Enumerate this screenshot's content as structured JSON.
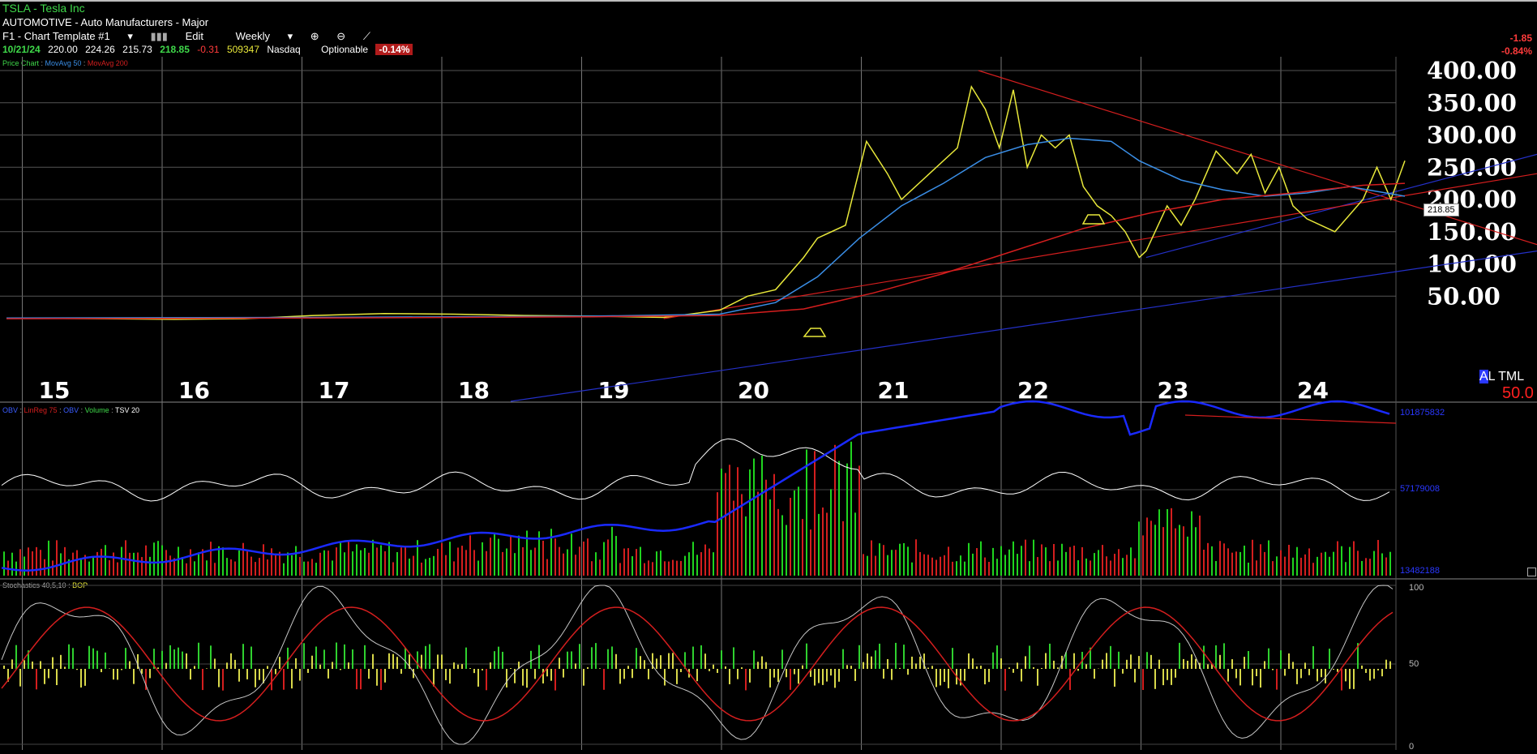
{
  "header": {
    "symbol_line": "TSLA - Tesla Inc",
    "industry": "AUTOMOTIVE - Auto Manufacturers - Major",
    "template": "F1 - Chart Template #1",
    "edit_label": "Edit",
    "period": "Weekly",
    "quote": {
      "date": "10/21/24",
      "open": "220.00",
      "high": "224.26",
      "low": "215.73",
      "close": "218.85",
      "change": "-0.31",
      "volume": "509347",
      "exchange": "Nasdaq",
      "optionable": "Optionable",
      "pct": "-0.14%"
    },
    "net_change": "-1.85",
    "net_pct": "-0.84%"
  },
  "legends": {
    "price": [
      "Price Chart",
      "MovAvg 50",
      "MovAvg 200"
    ],
    "volume": [
      "OBV",
      "LinReg 75",
      "OBV",
      "Volume",
      "TSV 20"
    ],
    "stoch": [
      "Stochastics 40,5,10",
      "BOP"
    ]
  },
  "side": {
    "altml": "AL TML",
    "fifty": "50.0",
    "last_price": "218.85"
  },
  "colors": {
    "price": "#e8e83a",
    "ma50": "#3a8ee6",
    "ma200": "#d41e1e",
    "trend_red": "#d41e1e",
    "trend_blue": "#2430c8",
    "obv": "#1a2aff",
    "tsv": "#ffffff",
    "vol_up": "#1fd41f",
    "vol_down": "#d41e1e",
    "stoch_k": "#c8c8c8",
    "stoch_d": "#d41e1e",
    "bop_up": "#2fd12f",
    "bop_mid": "#d8d84a",
    "bop_down": "#d41e1e"
  },
  "chart_data": [
    {
      "type": "line",
      "name": "price",
      "x": [
        2014.8,
        2015.5,
        2016.0,
        2016.5,
        2017.0,
        2017.5,
        2018.0,
        2018.5,
        2019.0,
        2019.5,
        2019.9,
        2020.1,
        2020.3,
        2020.5,
        2020.6,
        2020.8,
        2020.95,
        2021.1,
        2021.2,
        2021.4,
        2021.6,
        2021.7,
        2021.8,
        2021.9,
        2022.0,
        2022.1,
        2022.2,
        2022.3,
        2022.4,
        2022.5,
        2022.6,
        2022.7,
        2022.8,
        2022.9,
        2022.95,
        2023.1,
        2023.2,
        2023.3,
        2023.45,
        2023.6,
        2023.7,
        2023.8,
        2023.9,
        2024.0,
        2024.1,
        2024.3,
        2024.5,
        2024.6,
        2024.7,
        2024.8
      ],
      "y": [
        16,
        15,
        14,
        15,
        20,
        23,
        22,
        20,
        19,
        17,
        28,
        50,
        60,
        110,
        140,
        160,
        290,
        240,
        200,
        240,
        280,
        375,
        340,
        280,
        370,
        250,
        300,
        280,
        300,
        220,
        190,
        175,
        150,
        110,
        120,
        190,
        160,
        200,
        275,
        240,
        270,
        210,
        250,
        190,
        170,
        150,
        200,
        250,
        200,
        260
      ],
      "xticks": [
        "15",
        "16",
        "17",
        "18",
        "19",
        "20",
        "21",
        "22",
        "23",
        "24"
      ],
      "yticks": [
        "400.00",
        "350.00",
        "300.00",
        "250.00",
        "200.00",
        "150.00",
        "100.00",
        "50.00"
      ],
      "ylim": [
        20,
        410
      ]
    },
    {
      "type": "line",
      "name": "MovAvg 50",
      "x": [
        2014.8,
        2017.0,
        2019.0,
        2019.9,
        2020.3,
        2020.6,
        2020.9,
        2021.2,
        2021.5,
        2021.8,
        2022.1,
        2022.4,
        2022.7,
        2022.9,
        2023.2,
        2023.5,
        2023.8,
        2024.1,
        2024.4,
        2024.8
      ],
      "y": [
        16,
        17,
        19,
        22,
        40,
        80,
        140,
        190,
        225,
        265,
        285,
        295,
        290,
        260,
        230,
        215,
        205,
        210,
        220,
        205
      ]
    },
    {
      "type": "line",
      "name": "MovAvg 200",
      "x": [
        2014.8,
        2017.0,
        2019.0,
        2019.9,
        2020.5,
        2021.0,
        2021.5,
        2022.0,
        2022.5,
        2023.0,
        2023.5,
        2024.0,
        2024.5,
        2024.8
      ],
      "y": [
        15,
        16,
        18,
        20,
        30,
        55,
        85,
        120,
        155,
        180,
        200,
        210,
        222,
        225
      ]
    },
    {
      "type": "bar",
      "name": "Volume",
      "ylim": [
        "13482188",
        "101875832"
      ],
      "midlabel": "57179008"
    },
    {
      "type": "line",
      "name": "Stochastics 40,5,10",
      "yticks": [
        "100",
        "50",
        "0"
      ],
      "ylim": [
        0,
        100
      ]
    }
  ]
}
